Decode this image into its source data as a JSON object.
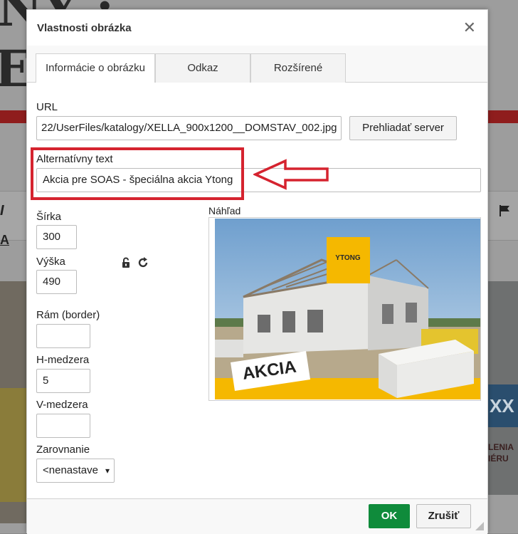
{
  "background_page": {
    "headline_fragment_1": "NY :",
    "headline_fragment_2": "E",
    "right_banner_text": "XX",
    "right_banner_lines": [
      "LENIA",
      "IÉRU"
    ],
    "colors": {
      "red_bar": "#8f1d1d",
      "banner_blue": "#2a4e6e"
    }
  },
  "dialog": {
    "title": "Vlastnosti obrázka",
    "close_icon": "close-icon",
    "tabs": [
      {
        "label": "Informácie o obrázku",
        "active": true
      },
      {
        "label": "Odkaz",
        "active": false
      },
      {
        "label": "Rozšírené",
        "active": false
      }
    ],
    "url": {
      "label": "URL",
      "value": "22/UserFiles/katalogy/XELLA_900x1200__DOMSTAV_002.jpg",
      "browse_button": "Prehliadať server"
    },
    "alt_text": {
      "label": "Alternatívny text",
      "value": "Akcia pre SOAS - špeciálna akcia Ytong"
    },
    "width": {
      "label": "Šírka",
      "value": "300"
    },
    "height": {
      "label": "Výška",
      "value": "490"
    },
    "lock_icon": "lock-icon",
    "reset_icon": "reset-size-icon",
    "border": {
      "label": "Rám (border)",
      "value": ""
    },
    "hspace": {
      "label": "H-medzera",
      "value": "5"
    },
    "vspace": {
      "label": "V-medzera",
      "value": ""
    },
    "align": {
      "label": "Zarovnanie",
      "value": "<nenastave"
    },
    "preview": {
      "label": "Náhľad",
      "logo_text": "YTONG",
      "banner_text": "AKCIA"
    },
    "footer": {
      "ok": "OK",
      "cancel": "Zrušiť"
    },
    "annotation": {
      "color": "#d5232f",
      "arrow_icon": "left-arrow-annotation"
    },
    "colors": {
      "ok_green": "#0f8b3b",
      "ytong_yellow": "#f5b800"
    }
  }
}
